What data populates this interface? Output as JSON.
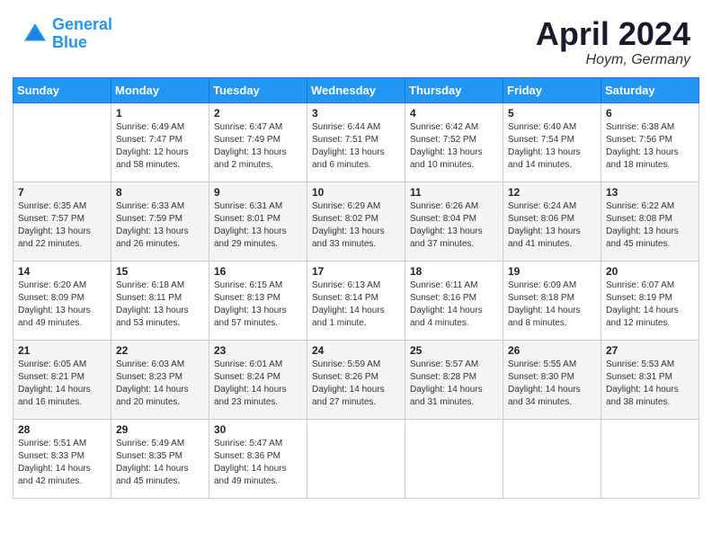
{
  "header": {
    "logo_line1": "General",
    "logo_line2": "Blue",
    "month": "April 2024",
    "location": "Hoym, Germany"
  },
  "days_of_week": [
    "Sunday",
    "Monday",
    "Tuesday",
    "Wednesday",
    "Thursday",
    "Friday",
    "Saturday"
  ],
  "weeks": [
    [
      {
        "day": "",
        "sunrise": "",
        "sunset": "",
        "daylight": ""
      },
      {
        "day": "1",
        "sunrise": "Sunrise: 6:49 AM",
        "sunset": "Sunset: 7:47 PM",
        "daylight": "Daylight: 12 hours and 58 minutes."
      },
      {
        "day": "2",
        "sunrise": "Sunrise: 6:47 AM",
        "sunset": "Sunset: 7:49 PM",
        "daylight": "Daylight: 13 hours and 2 minutes."
      },
      {
        "day": "3",
        "sunrise": "Sunrise: 6:44 AM",
        "sunset": "Sunset: 7:51 PM",
        "daylight": "Daylight: 13 hours and 6 minutes."
      },
      {
        "day": "4",
        "sunrise": "Sunrise: 6:42 AM",
        "sunset": "Sunset: 7:52 PM",
        "daylight": "Daylight: 13 hours and 10 minutes."
      },
      {
        "day": "5",
        "sunrise": "Sunrise: 6:40 AM",
        "sunset": "Sunset: 7:54 PM",
        "daylight": "Daylight: 13 hours and 14 minutes."
      },
      {
        "day": "6",
        "sunrise": "Sunrise: 6:38 AM",
        "sunset": "Sunset: 7:56 PM",
        "daylight": "Daylight: 13 hours and 18 minutes."
      }
    ],
    [
      {
        "day": "7",
        "sunrise": "Sunrise: 6:35 AM",
        "sunset": "Sunset: 7:57 PM",
        "daylight": "Daylight: 13 hours and 22 minutes."
      },
      {
        "day": "8",
        "sunrise": "Sunrise: 6:33 AM",
        "sunset": "Sunset: 7:59 PM",
        "daylight": "Daylight: 13 hours and 26 minutes."
      },
      {
        "day": "9",
        "sunrise": "Sunrise: 6:31 AM",
        "sunset": "Sunset: 8:01 PM",
        "daylight": "Daylight: 13 hours and 29 minutes."
      },
      {
        "day": "10",
        "sunrise": "Sunrise: 6:29 AM",
        "sunset": "Sunset: 8:02 PM",
        "daylight": "Daylight: 13 hours and 33 minutes."
      },
      {
        "day": "11",
        "sunrise": "Sunrise: 6:26 AM",
        "sunset": "Sunset: 8:04 PM",
        "daylight": "Daylight: 13 hours and 37 minutes."
      },
      {
        "day": "12",
        "sunrise": "Sunrise: 6:24 AM",
        "sunset": "Sunset: 8:06 PM",
        "daylight": "Daylight: 13 hours and 41 minutes."
      },
      {
        "day": "13",
        "sunrise": "Sunrise: 6:22 AM",
        "sunset": "Sunset: 8:08 PM",
        "daylight": "Daylight: 13 hours and 45 minutes."
      }
    ],
    [
      {
        "day": "14",
        "sunrise": "Sunrise: 6:20 AM",
        "sunset": "Sunset: 8:09 PM",
        "daylight": "Daylight: 13 hours and 49 minutes."
      },
      {
        "day": "15",
        "sunrise": "Sunrise: 6:18 AM",
        "sunset": "Sunset: 8:11 PM",
        "daylight": "Daylight: 13 hours and 53 minutes."
      },
      {
        "day": "16",
        "sunrise": "Sunrise: 6:15 AM",
        "sunset": "Sunset: 8:13 PM",
        "daylight": "Daylight: 13 hours and 57 minutes."
      },
      {
        "day": "17",
        "sunrise": "Sunrise: 6:13 AM",
        "sunset": "Sunset: 8:14 PM",
        "daylight": "Daylight: 14 hours and 1 minute."
      },
      {
        "day": "18",
        "sunrise": "Sunrise: 6:11 AM",
        "sunset": "Sunset: 8:16 PM",
        "daylight": "Daylight: 14 hours and 4 minutes."
      },
      {
        "day": "19",
        "sunrise": "Sunrise: 6:09 AM",
        "sunset": "Sunset: 8:18 PM",
        "daylight": "Daylight: 14 hours and 8 minutes."
      },
      {
        "day": "20",
        "sunrise": "Sunrise: 6:07 AM",
        "sunset": "Sunset: 8:19 PM",
        "daylight": "Daylight: 14 hours and 12 minutes."
      }
    ],
    [
      {
        "day": "21",
        "sunrise": "Sunrise: 6:05 AM",
        "sunset": "Sunset: 8:21 PM",
        "daylight": "Daylight: 14 hours and 16 minutes."
      },
      {
        "day": "22",
        "sunrise": "Sunrise: 6:03 AM",
        "sunset": "Sunset: 8:23 PM",
        "daylight": "Daylight: 14 hours and 20 minutes."
      },
      {
        "day": "23",
        "sunrise": "Sunrise: 6:01 AM",
        "sunset": "Sunset: 8:24 PM",
        "daylight": "Daylight: 14 hours and 23 minutes."
      },
      {
        "day": "24",
        "sunrise": "Sunrise: 5:59 AM",
        "sunset": "Sunset: 8:26 PM",
        "daylight": "Daylight: 14 hours and 27 minutes."
      },
      {
        "day": "25",
        "sunrise": "Sunrise: 5:57 AM",
        "sunset": "Sunset: 8:28 PM",
        "daylight": "Daylight: 14 hours and 31 minutes."
      },
      {
        "day": "26",
        "sunrise": "Sunrise: 5:55 AM",
        "sunset": "Sunset: 8:30 PM",
        "daylight": "Daylight: 14 hours and 34 minutes."
      },
      {
        "day": "27",
        "sunrise": "Sunrise: 5:53 AM",
        "sunset": "Sunset: 8:31 PM",
        "daylight": "Daylight: 14 hours and 38 minutes."
      }
    ],
    [
      {
        "day": "28",
        "sunrise": "Sunrise: 5:51 AM",
        "sunset": "Sunset: 8:33 PM",
        "daylight": "Daylight: 14 hours and 42 minutes."
      },
      {
        "day": "29",
        "sunrise": "Sunrise: 5:49 AM",
        "sunset": "Sunset: 8:35 PM",
        "daylight": "Daylight: 14 hours and 45 minutes."
      },
      {
        "day": "30",
        "sunrise": "Sunrise: 5:47 AM",
        "sunset": "Sunset: 8:36 PM",
        "daylight": "Daylight: 14 hours and 49 minutes."
      },
      {
        "day": "",
        "sunrise": "",
        "sunset": "",
        "daylight": ""
      },
      {
        "day": "",
        "sunrise": "",
        "sunset": "",
        "daylight": ""
      },
      {
        "day": "",
        "sunrise": "",
        "sunset": "",
        "daylight": ""
      },
      {
        "day": "",
        "sunrise": "",
        "sunset": "",
        "daylight": ""
      }
    ]
  ]
}
